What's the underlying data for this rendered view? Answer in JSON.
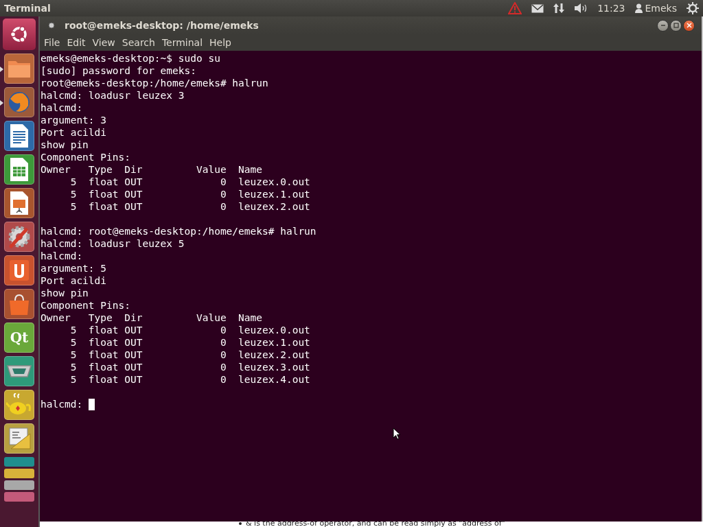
{
  "panel": {
    "app_title": "Terminal",
    "clock": "11:23",
    "user": "Emeks"
  },
  "launcher": {
    "items": [
      {
        "kind": "folder",
        "running": true
      },
      {
        "kind": "browser",
        "running": true
      },
      {
        "kind": "writer",
        "running": false
      },
      {
        "kind": "calc",
        "running": false
      },
      {
        "kind": "impress",
        "running": false
      },
      {
        "kind": "settings",
        "running": false
      },
      {
        "kind": "software",
        "running": false
      },
      {
        "kind": "bag",
        "running": false
      },
      {
        "kind": "qt",
        "running": false,
        "glyph": "Qt"
      },
      {
        "kind": "port",
        "running": false
      },
      {
        "kind": "teapot",
        "running": false
      },
      {
        "kind": "editor",
        "running": false
      }
    ],
    "stack": [
      {
        "color": "#1f8e8e"
      },
      {
        "color": "#d8b23a"
      },
      {
        "color": "#a8a8a8"
      },
      {
        "color": "#c45a7a"
      }
    ]
  },
  "window": {
    "title": "root@emeks-desktop: /home/emeks",
    "menu": [
      "File",
      "Edit",
      "View",
      "Search",
      "Terminal",
      "Help"
    ]
  },
  "terminal": {
    "blocks": [
      [
        "emeks@emeks-desktop:~$ sudo su",
        "[sudo] password for emeks:",
        "root@emeks-desktop:/home/emeks# halrun",
        "halcmd: loadusr leuzex 3",
        "halcmd:",
        "argument: 3",
        "Port acildi",
        "show pin",
        "Component Pins:",
        "Owner   Type  Dir         Value  Name",
        "     5  float OUT             0  leuzex.0.out",
        "     5  float OUT             0  leuzex.1.out",
        "     5  float OUT             0  leuzex.2.out"
      ],
      [
        "halcmd: root@emeks-desktop:/home/emeks# halrun",
        "halcmd: loadusr leuzex 5",
        "halcmd:",
        "argument: 5",
        "Port acildi",
        "show pin",
        "Component Pins:",
        "Owner   Type  Dir         Value  Name",
        "     5  float OUT             0  leuzex.0.out",
        "     5  float OUT             0  leuzex.1.out",
        "     5  float OUT             0  leuzex.2.out",
        "     5  float OUT             0  leuzex.3.out",
        "     5  float OUT             0  leuzex.4.out"
      ]
    ],
    "prompt": "halcmd:",
    "cursor": true
  },
  "background_text": "& is the address-of operator, and can be read simply as \"address of\""
}
